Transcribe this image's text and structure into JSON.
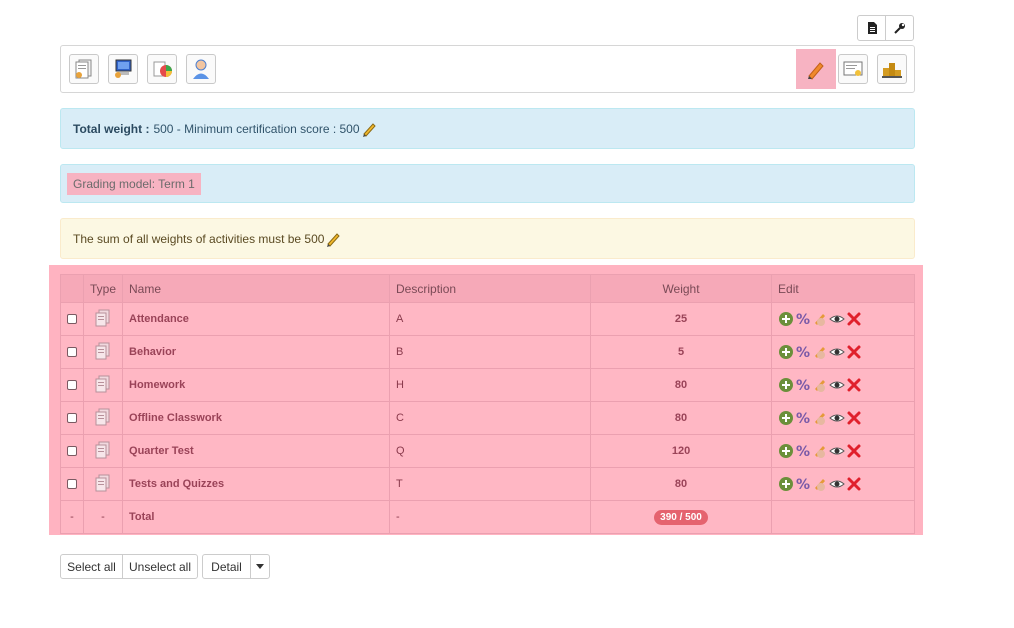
{
  "alerts": {
    "weight_label": "Total weight :",
    "weight_text": "500 - Minimum certification score : 500",
    "grading_model": "Grading model: Term 1",
    "sum_text": "The sum of all weights of activities must be 500"
  },
  "table": {
    "headers": [
      "",
      "Type",
      "Name",
      "Description",
      "Weight",
      "Edit"
    ],
    "rows": [
      {
        "name": "Attendance",
        "description": "A",
        "weight": "25"
      },
      {
        "name": "Behavior",
        "description": "B",
        "weight": "5"
      },
      {
        "name": "Homework",
        "description": "H",
        "weight": "80"
      },
      {
        "name": "Offline Classwork",
        "description": "C",
        "weight": "80"
      },
      {
        "name": "Quarter Test",
        "description": "Q",
        "weight": "120"
      },
      {
        "name": "Tests and Quizzes",
        "description": "T",
        "weight": "80"
      }
    ],
    "total": {
      "check": "-",
      "type": "-",
      "name": "Total",
      "description": "-",
      "weight": "390 / 500"
    }
  },
  "buttons": {
    "select_all": "Select all",
    "unselect_all": "Unselect all",
    "detail": "Detail"
  },
  "colors": {
    "highlight": "#ffb3c1",
    "info_bg": "#d9edf7",
    "warning_bg": "#fcf8e3",
    "badge": "#e5636f"
  },
  "icons": {
    "top_right": [
      "document-icon",
      "wrench-icon"
    ],
    "toolbar_left": [
      "add-document-icon",
      "computer-settings-icon",
      "pie-chart-icon",
      "user-icon"
    ],
    "toolbar_right": [
      "pencil-icon",
      "certificate-icon",
      "podium-icon"
    ],
    "row_edit": [
      "add-icon",
      "percent-icon",
      "pen-hand-icon",
      "eye-icon",
      "delete-icon"
    ]
  }
}
